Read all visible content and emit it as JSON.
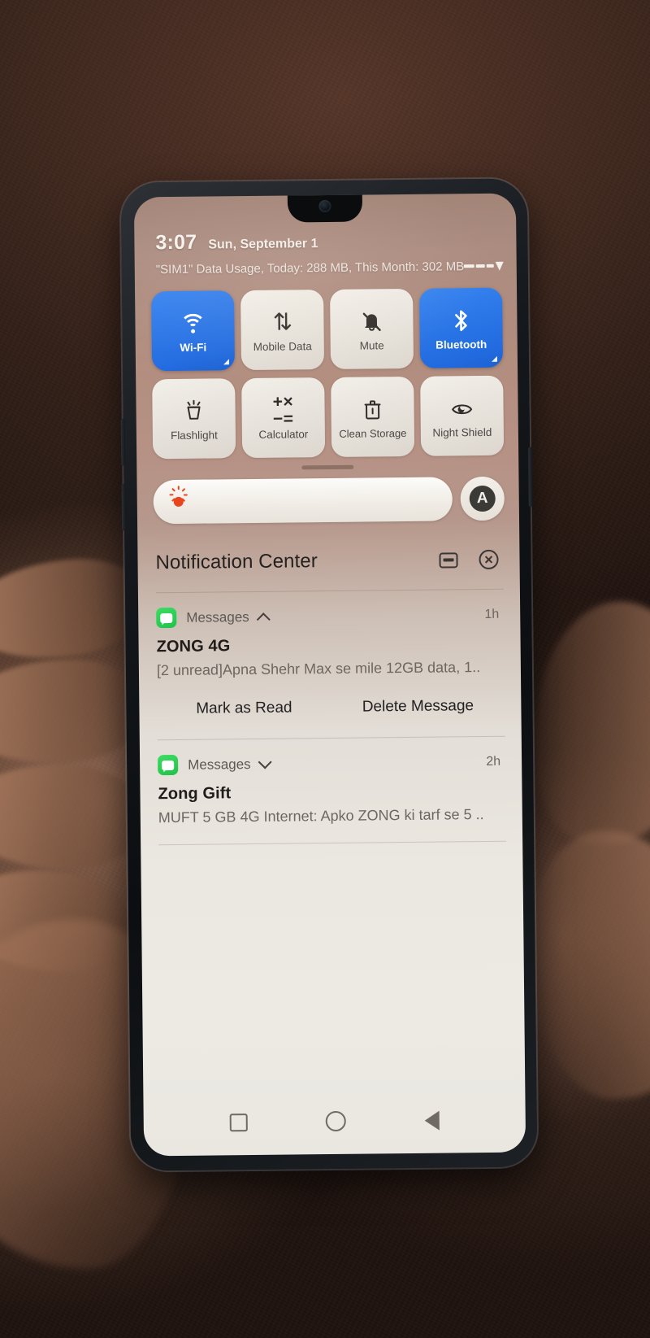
{
  "status_bar": {
    "time": "3:07",
    "date": "Sun, September 1",
    "data_usage": "\"SIM1\" Data Usage, Today: 288 MB, This Month: 302 MB",
    "signal_icon": "signal-bars-icon",
    "battery_icon": "battery-hex-icon"
  },
  "quick_settings": {
    "tiles": [
      {
        "label": "Wi-Fi",
        "icon": "wifi-icon",
        "active": true,
        "has_corner": true
      },
      {
        "label": "Mobile Data",
        "icon": "mobile-data-icon",
        "active": false,
        "has_corner": false
      },
      {
        "label": "Mute",
        "icon": "bell-mute-icon",
        "active": false,
        "has_corner": false
      },
      {
        "label": "Bluetooth",
        "icon": "bluetooth-icon",
        "active": true,
        "has_corner": true
      },
      {
        "label": "Flashlight",
        "icon": "flashlight-icon",
        "active": false,
        "has_corner": false
      },
      {
        "label": "Calculator",
        "icon": "calculator-icon",
        "active": false,
        "has_corner": false
      },
      {
        "label": "Clean Storage",
        "icon": "trash-clean-icon",
        "active": false,
        "has_corner": false
      },
      {
        "label": "Night Shield",
        "icon": "night-shield-icon",
        "active": false,
        "has_corner": false
      }
    ]
  },
  "brightness": {
    "slider_icon": "sun-brightness-icon",
    "auto_label": "A",
    "value_percent": 100
  },
  "notification_center": {
    "title": "Notification Center",
    "quiet_icon": "do-not-disturb-icon",
    "clear_all_icon": "clear-all-circle-x-icon",
    "notifications": [
      {
        "app_name": "Messages",
        "app_icon": "messages-icon",
        "expanded": true,
        "chevron": "chevron-up-icon",
        "time": "1h",
        "title": "ZONG 4G",
        "body": "[2 unread]Apna Shehr Max se mile 12GB data, 1..",
        "actions": [
          "Mark as Read",
          "Delete Message"
        ]
      },
      {
        "app_name": "Messages",
        "app_icon": "messages-icon",
        "expanded": false,
        "chevron": "chevron-down-icon",
        "time": "2h",
        "title": "Zong Gift",
        "body": "MUFT 5 GB 4G Internet: Apko ZONG ki tarf se 5 ..",
        "actions": []
      }
    ]
  },
  "nav_bar": {
    "recents_icon": "square-recents-icon",
    "home_icon": "circle-home-icon",
    "back_icon": "triangle-back-icon"
  },
  "colors": {
    "accent_blue": "#2f7ff0",
    "messages_green": "#21c24a",
    "brightness_orange": "#e8441c"
  }
}
